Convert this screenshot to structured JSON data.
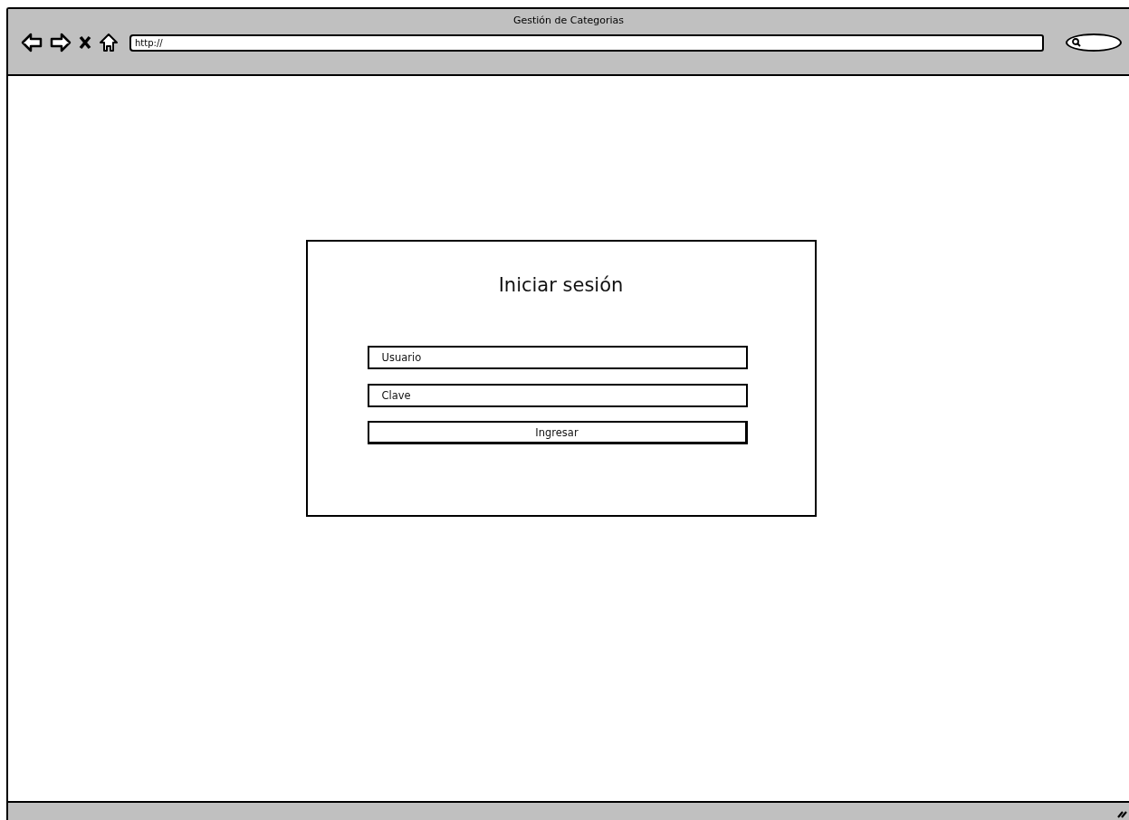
{
  "window": {
    "title": "Gestión de Categorias"
  },
  "address_bar": {
    "value": "http://"
  },
  "login": {
    "title": "Iniciar sesión",
    "fields": [
      {
        "value": "Usuario"
      },
      {
        "value": "Clave"
      }
    ],
    "button": "Ingresar"
  }
}
